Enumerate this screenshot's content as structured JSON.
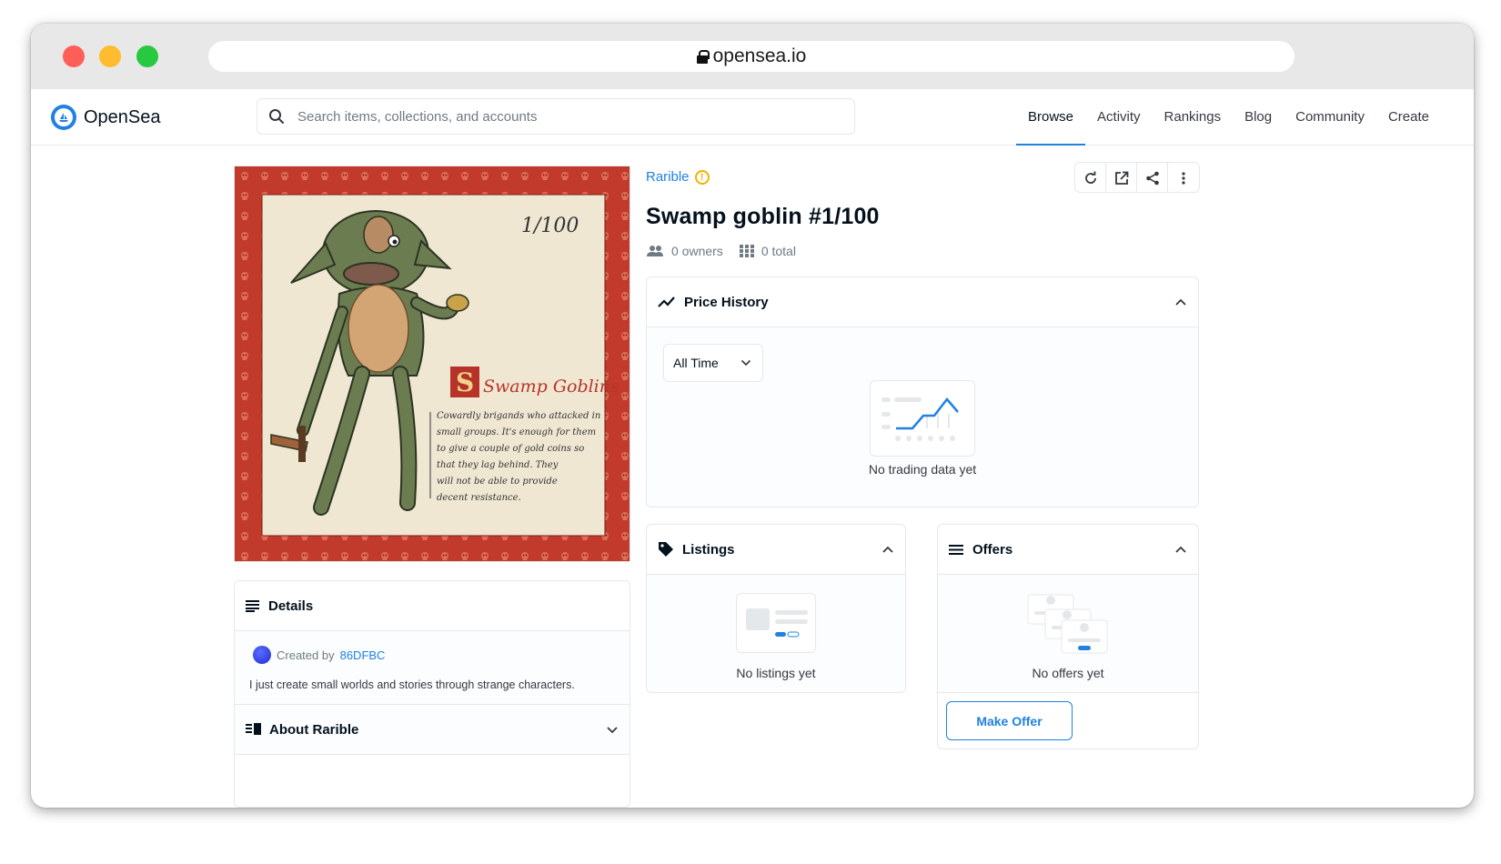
{
  "browser": {
    "url": "opensea.io"
  },
  "nav": {
    "logo_text": "OpenSea",
    "search_placeholder": "Search items, collections, and accounts",
    "links": [
      "Browse",
      "Activity",
      "Rankings",
      "Blog",
      "Community",
      "Create"
    ],
    "active": "Browse"
  },
  "item": {
    "collection": "Rarible",
    "title": "Swamp goblin #1/100",
    "owners": "0 owners",
    "total": "0 total"
  },
  "artwork": {
    "edition": "1/100",
    "heading": "Swamp Goblins",
    "caption_lines": [
      "Cowardly brigands who attacked in",
      "small groups. It's enough for them",
      "to give a couple of gold coins so",
      "that they lag behind. They",
      "will not be able to provide",
      "decent resistance."
    ]
  },
  "details": {
    "heading": "Details",
    "created_by_label": "Created by",
    "creator": "86DFBC",
    "bio": "I just create small worlds and stories through strange characters.",
    "about_heading": "About Rarible"
  },
  "price_history": {
    "heading": "Price History",
    "range": "All Time",
    "empty": "No trading data yet"
  },
  "listings": {
    "heading": "Listings",
    "empty": "No listings yet"
  },
  "offers": {
    "heading": "Offers",
    "empty": "No offers yet",
    "button": "Make Offer"
  },
  "colors": {
    "accent": "#2081e2",
    "warning": "#f5b000",
    "frame": "#c0392b"
  }
}
